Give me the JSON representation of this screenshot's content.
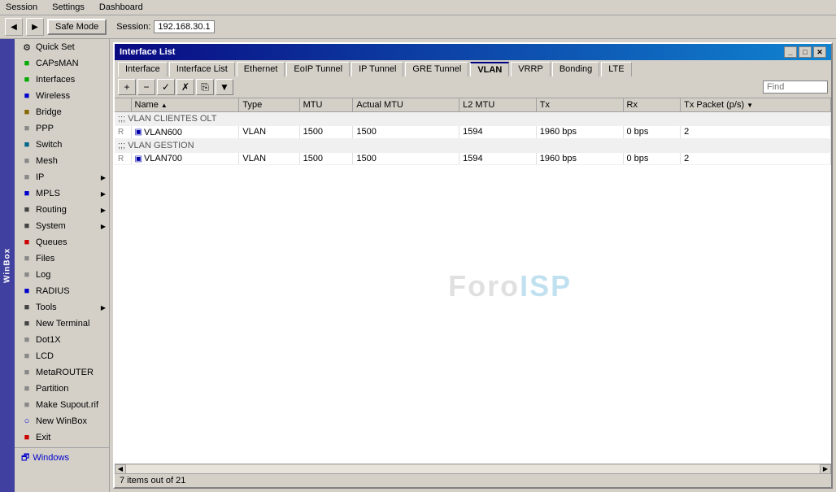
{
  "menubar": {
    "items": [
      "Session",
      "Settings",
      "Dashboard"
    ]
  },
  "toolbar": {
    "safe_mode_label": "Safe Mode",
    "session_label": "Session:",
    "session_value": "192.168.30.1",
    "back_btn": "◀",
    "forward_btn": "▶"
  },
  "sidebar": {
    "winbox_label": "WinBox",
    "items": [
      {
        "id": "quick-set",
        "label": "Quick Set",
        "icon": "⚙",
        "color": "green",
        "arrow": false
      },
      {
        "id": "capsman",
        "label": "CAPsMAN",
        "icon": "📡",
        "color": "green",
        "arrow": false
      },
      {
        "id": "interfaces",
        "label": "Interfaces",
        "icon": "■",
        "color": "green",
        "arrow": false
      },
      {
        "id": "wireless",
        "label": "Wireless",
        "icon": "■",
        "color": "blue",
        "arrow": false
      },
      {
        "id": "bridge",
        "label": "Bridge",
        "icon": "■",
        "color": "orange",
        "arrow": false
      },
      {
        "id": "ppp",
        "label": "PPP",
        "icon": "■",
        "color": "gray",
        "arrow": false
      },
      {
        "id": "switch",
        "label": "Switch",
        "icon": "■",
        "color": "teal",
        "arrow": false
      },
      {
        "id": "mesh",
        "label": "Mesh",
        "icon": "■",
        "color": "gray",
        "arrow": false
      },
      {
        "id": "ip",
        "label": "IP",
        "icon": "■",
        "color": "gray",
        "arrow": true
      },
      {
        "id": "mpls",
        "label": "MPLS",
        "icon": "■",
        "color": "blue",
        "arrow": true
      },
      {
        "id": "routing",
        "label": "Routing",
        "icon": "■",
        "color": "dark",
        "arrow": true
      },
      {
        "id": "system",
        "label": "System",
        "icon": "■",
        "color": "gray",
        "arrow": true
      },
      {
        "id": "queues",
        "label": "Queues",
        "icon": "■",
        "color": "red",
        "arrow": false
      },
      {
        "id": "files",
        "label": "Files",
        "icon": "■",
        "color": "gray",
        "arrow": false
      },
      {
        "id": "log",
        "label": "Log",
        "icon": "■",
        "color": "gray",
        "arrow": false
      },
      {
        "id": "radius",
        "label": "RADIUS",
        "icon": "■",
        "color": "blue",
        "arrow": false
      },
      {
        "id": "tools",
        "label": "Tools",
        "icon": "■",
        "color": "gray",
        "arrow": true
      },
      {
        "id": "new-terminal",
        "label": "New Terminal",
        "icon": "■",
        "color": "gray",
        "arrow": false
      },
      {
        "id": "dot1x",
        "label": "Dot1X",
        "icon": "■",
        "color": "gray",
        "arrow": false
      },
      {
        "id": "lcd",
        "label": "LCD",
        "icon": "■",
        "color": "gray",
        "arrow": false
      },
      {
        "id": "metarouter",
        "label": "MetaROUTER",
        "icon": "■",
        "color": "gray",
        "arrow": false
      },
      {
        "id": "partition",
        "label": "Partition",
        "icon": "■",
        "color": "gray",
        "arrow": false
      },
      {
        "id": "make-supout",
        "label": "Make Supout.rif",
        "icon": "■",
        "color": "gray",
        "arrow": false
      },
      {
        "id": "new-winbox",
        "label": "New WinBox",
        "icon": "■",
        "color": "blue",
        "arrow": false
      },
      {
        "id": "exit",
        "label": "Exit",
        "icon": "■",
        "color": "red",
        "arrow": false
      }
    ],
    "windows_label": "Windows"
  },
  "window": {
    "title": "Interface List",
    "tabs": [
      {
        "id": "interface",
        "label": "Interface"
      },
      {
        "id": "interface-list",
        "label": "Interface List"
      },
      {
        "id": "ethernet",
        "label": "Ethernet"
      },
      {
        "id": "eoip-tunnel",
        "label": "EoIP Tunnel"
      },
      {
        "id": "ip-tunnel",
        "label": "IP Tunnel"
      },
      {
        "id": "gre-tunnel",
        "label": "GRE Tunnel"
      },
      {
        "id": "vlan",
        "label": "VLAN",
        "active": true
      },
      {
        "id": "vrrp",
        "label": "VRRP"
      },
      {
        "id": "bonding",
        "label": "Bonding"
      },
      {
        "id": "lte",
        "label": "LTE"
      }
    ],
    "toolbar": {
      "add_btn": "+",
      "remove_btn": "−",
      "enable_btn": "✓",
      "disable_btn": "✗",
      "copy_btn": "⎘",
      "filter_btn": "▼",
      "find_placeholder": "Find"
    },
    "table": {
      "columns": [
        "",
        "Name",
        "Type",
        "MTU",
        "Actual MTU",
        "L2 MTU",
        "Tx",
        "Rx",
        "Tx Packet (p/s)"
      ],
      "groups": [
        {
          "group_label": ";;; VLAN CLIENTES OLT",
          "rows": [
            {
              "flag": "R",
              "name": "VLAN600",
              "type": "VLAN",
              "mtu": "1500",
              "actual_mtu": "1500",
              "l2_mtu": "1594",
              "tx": "1960 bps",
              "rx": "0 bps",
              "tx_packet": "2"
            }
          ]
        },
        {
          "group_label": ";;; VLAN GESTION",
          "rows": [
            {
              "flag": "R",
              "name": "VLAN700",
              "type": "VLAN",
              "mtu": "1500",
              "actual_mtu": "1500",
              "l2_mtu": "1594",
              "tx": "1960 bps",
              "rx": "0 bps",
              "tx_packet": "2"
            }
          ]
        }
      ]
    },
    "status_bar": "7 items out of 21",
    "watermark": {
      "part1": "Foro",
      "part2": "ISP"
    }
  }
}
